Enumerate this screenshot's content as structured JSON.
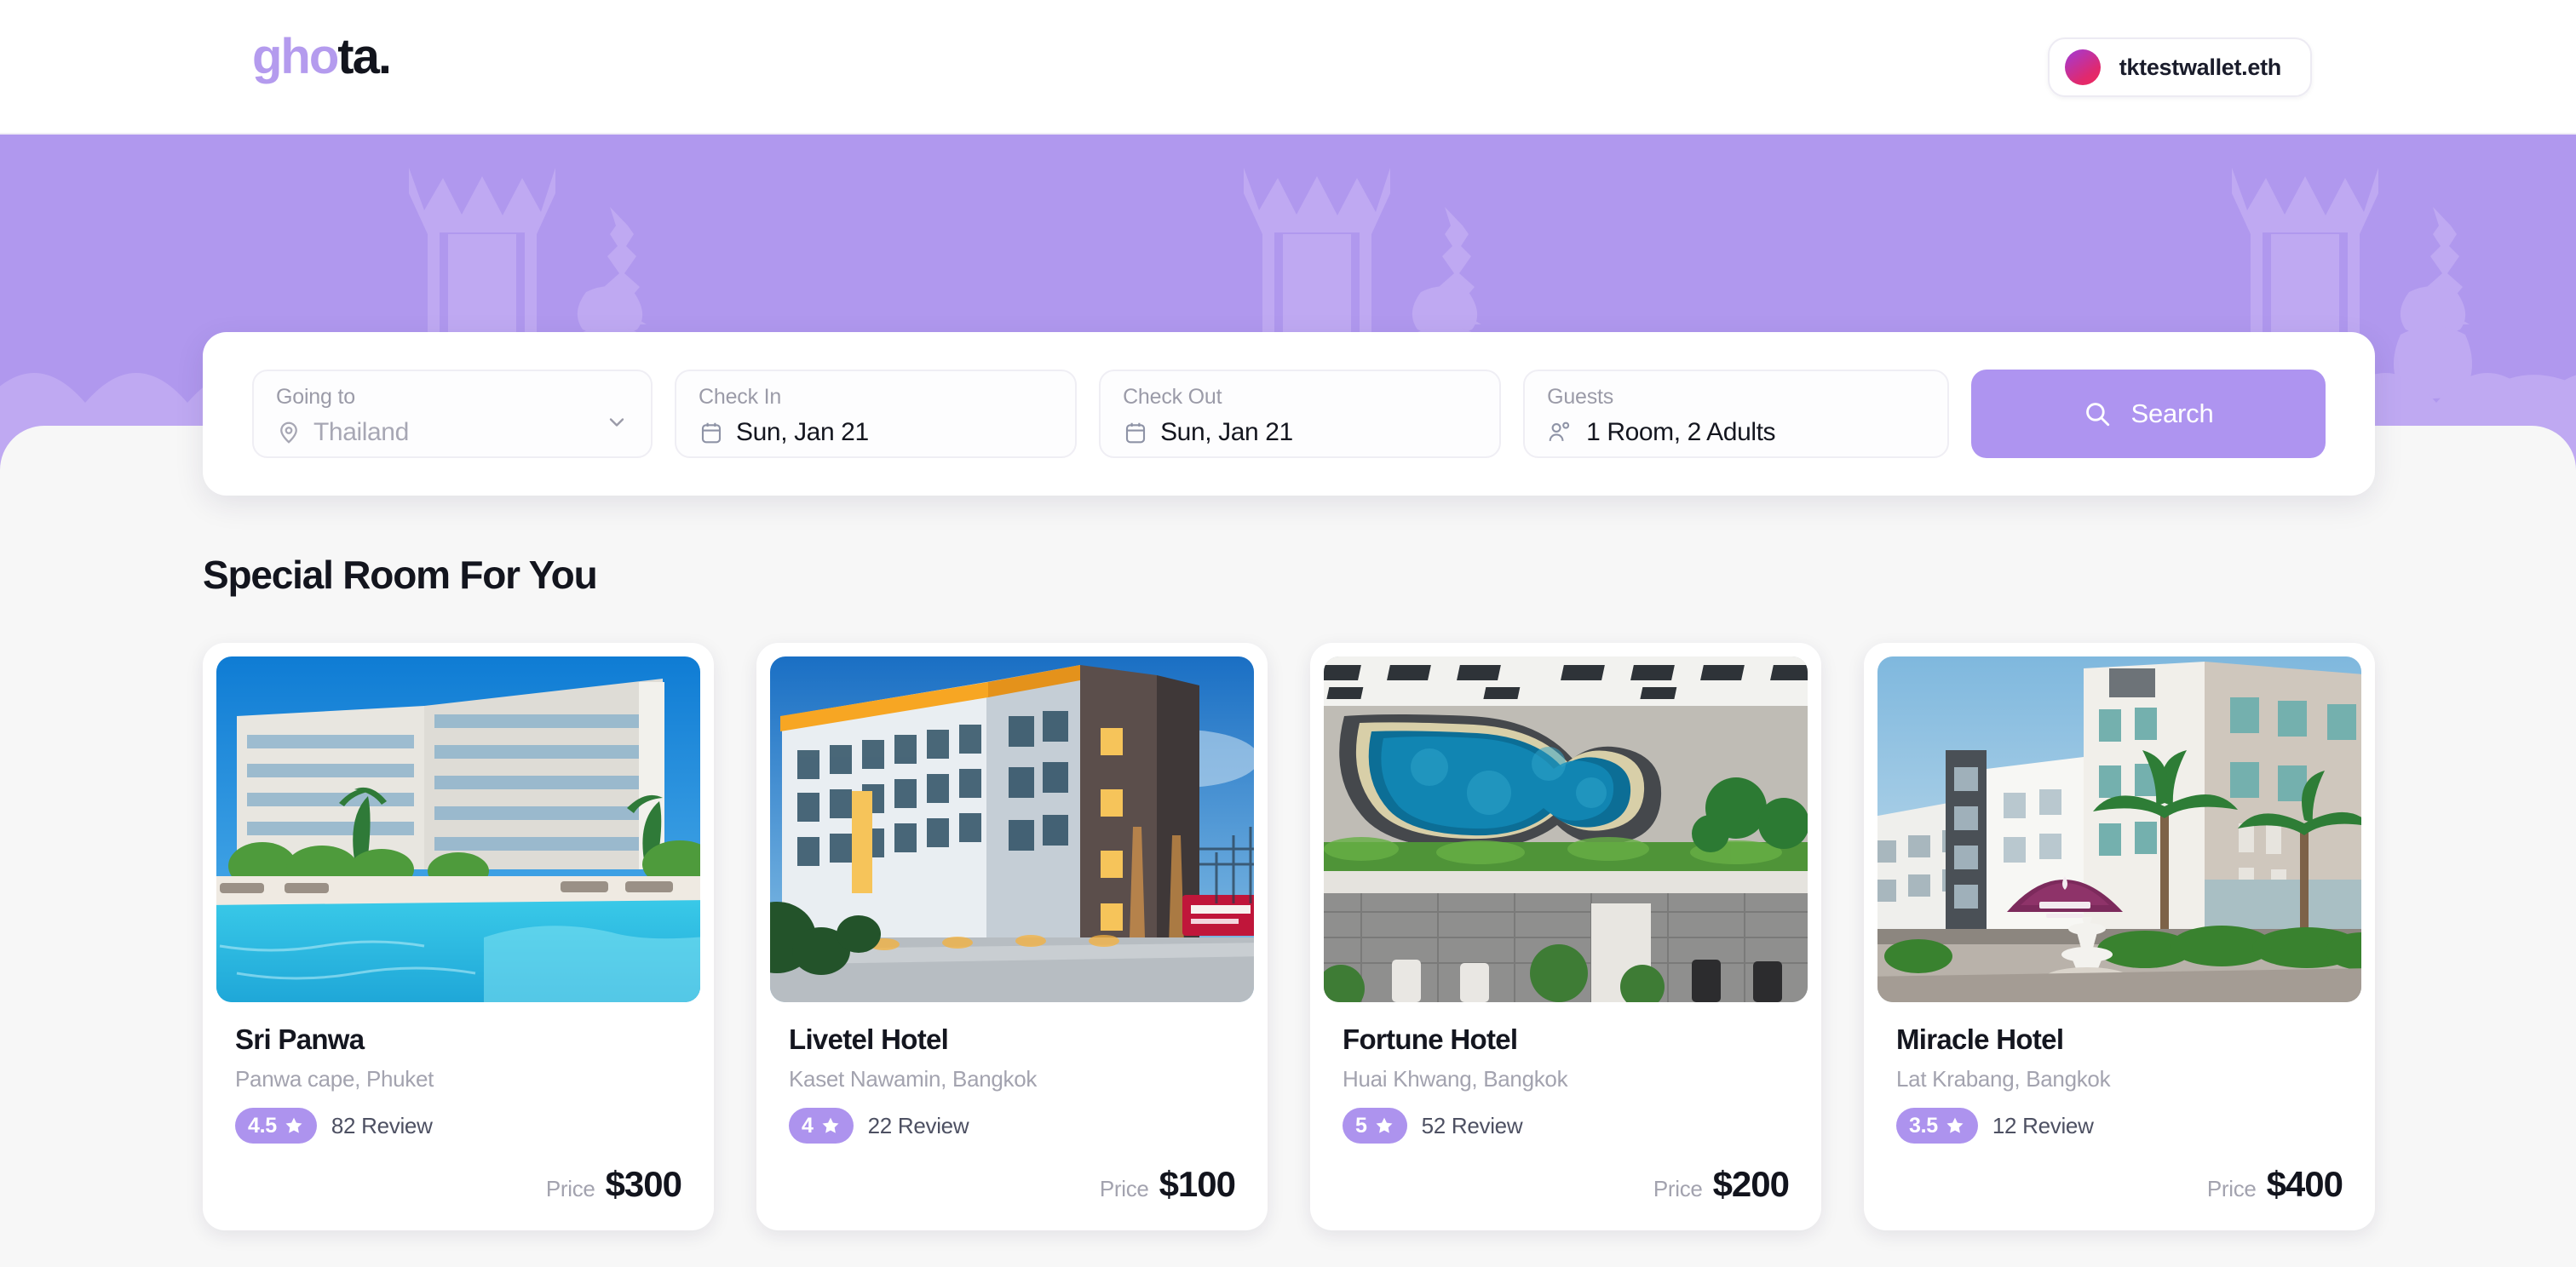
{
  "header": {
    "logo_purple": "gho",
    "logo_dark": "ta.",
    "wallet_label": "tktestwallet.eth"
  },
  "search": {
    "going_to": {
      "label": "Going to",
      "value": "Thailand",
      "is_placeholder": true,
      "icon": "location-pin-icon"
    },
    "check_in": {
      "label": "Check In",
      "value": "Sun, Jan 21",
      "icon": "calendar-icon"
    },
    "check_out": {
      "label": "Check Out",
      "value": "Sun, Jan 21",
      "icon": "calendar-icon"
    },
    "guests": {
      "label": "Guests",
      "value": "1 Room, 2 Adults",
      "icon": "people-icon"
    },
    "search_button": "Search",
    "search_button_color": "#AE94F0"
  },
  "main": {
    "section_title": "Special Room For You"
  },
  "cards": [
    {
      "name": "Sri Panwa",
      "location": "Panwa cape, Phuket",
      "rating": "4.5",
      "reviews": "82 Review",
      "price_label": "Price",
      "price": "$300",
      "image": "resort-pool-daytime"
    },
    {
      "name": "Livetel Hotel",
      "location": "Kaset Nawamin, Bangkok",
      "rating": "4",
      "reviews": "22 Review",
      "price_label": "Price",
      "price": "$100",
      "image": "city-hotel-dusk"
    },
    {
      "name": "Fortune Hotel",
      "location": "Huai Khwang, Bangkok",
      "rating": "5",
      "reviews": "52 Review",
      "price_label": "Price",
      "price": "$200",
      "image": "aerial-pool-view"
    },
    {
      "name": "Miracle Hotel",
      "location": "Lat Krabang, Bangkok",
      "rating": "3.5",
      "reviews": "12 Review",
      "price_label": "Price",
      "price": "$400",
      "image": "airport-hotel-palms"
    }
  ],
  "theme": {
    "hero_purple": "#B098EE",
    "accent_purple": "#AE94F0",
    "badge_purple": "#AD93EE",
    "page_bg": "#F7F7F7"
  }
}
